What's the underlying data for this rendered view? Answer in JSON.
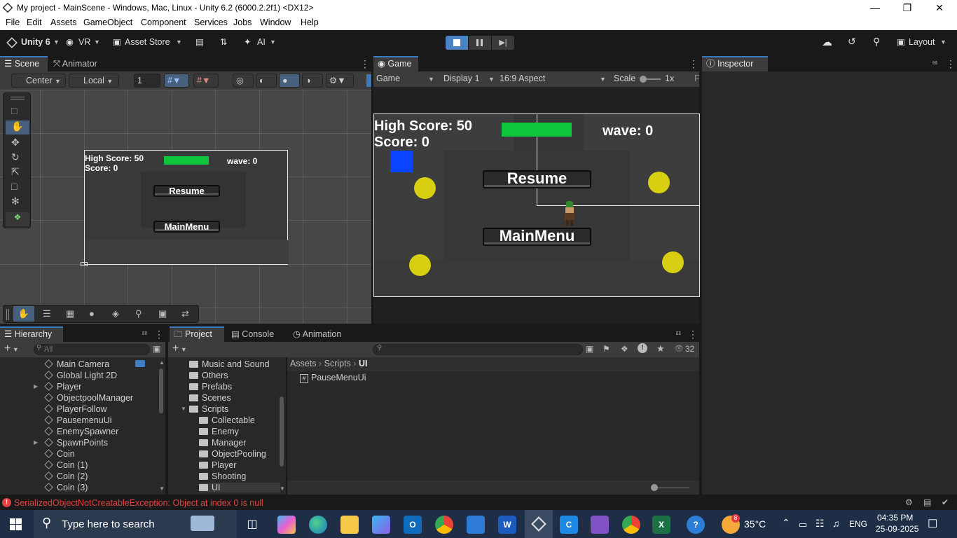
{
  "window": {
    "title": "My project - MainScene - Windows, Mac, Linux - Unity 6.2 (6000.2.2f1) <DX12>"
  },
  "menu": [
    "File",
    "Edit",
    "Assets",
    "GameObject",
    "Component",
    "Services",
    "Jobs",
    "Window",
    "Help"
  ],
  "toolbar": {
    "account": "Unity 6",
    "vr": "VR",
    "asset_store": "Asset Store",
    "ai": "AI",
    "layout": "Layout"
  },
  "scene": {
    "tabs": [
      "Scene",
      "Animator"
    ],
    "pivot": "Center",
    "space": "Local",
    "grid_value": "1",
    "ui": {
      "high_score": "High Score: 50",
      "score": "Score: 0",
      "wave": "wave: 0",
      "resume": "Resume",
      "main_menu": "MainMenu"
    }
  },
  "game": {
    "tab": "Game",
    "mode": "Game",
    "display": "Display 1",
    "aspect": "16:9 Aspect",
    "scale_label": "Scale",
    "scale_value": "1x",
    "clipped": "F",
    "ui": {
      "high_score": "High Score: 50",
      "score": "Score: 0",
      "wave": "wave: 0",
      "resume": "Resume",
      "main_menu": "MainMenu"
    }
  },
  "inspector": {
    "tab": "Inspector"
  },
  "hierarchy": {
    "tab": "Hierarchy",
    "search_placeholder": "All",
    "items": [
      {
        "label": "Main Camera",
        "expand": false
      },
      {
        "label": "Global Light 2D",
        "expand": false
      },
      {
        "label": "Player",
        "expand": true
      },
      {
        "label": "ObjectpoolManager",
        "expand": false
      },
      {
        "label": "PlayerFollow",
        "expand": false
      },
      {
        "label": "PausemenuUi",
        "expand": false
      },
      {
        "label": "EnemySpawner",
        "expand": false
      },
      {
        "label": "SpawnPoints",
        "expand": true
      },
      {
        "label": "Coin",
        "expand": false
      },
      {
        "label": "Coin (1)",
        "expand": false
      },
      {
        "label": "Coin (2)",
        "expand": false
      },
      {
        "label": "Coin (3)",
        "expand": false
      }
    ]
  },
  "project": {
    "tabs": [
      "Project",
      "Console",
      "Animation"
    ],
    "count": "32",
    "folders": [
      "Music and Sound",
      "Others",
      "Prefabs",
      "Scenes",
      "Scripts",
      "Collectable",
      "Enemy",
      "Manager",
      "ObjectPooling",
      "Player",
      "Shooting",
      "UI"
    ],
    "breadcrumb": [
      "Assets",
      "Scripts",
      "UI"
    ],
    "files": [
      "PauseMenuUi"
    ]
  },
  "status": {
    "error": "SerializedObjectNotCreatableException: Object at index 0 is null"
  },
  "taskbar": {
    "search_placeholder": "Type here to search",
    "weather": "35°C",
    "lang": "ENG",
    "time": "04:35 PM",
    "date": "25-09-2025",
    "outlook_badge": "8"
  },
  "colors": {
    "accent_blue": "#3a79bb",
    "health_green": "#0fc53a",
    "coin_yellow": "#d8cf12",
    "error_red": "#e24040"
  }
}
